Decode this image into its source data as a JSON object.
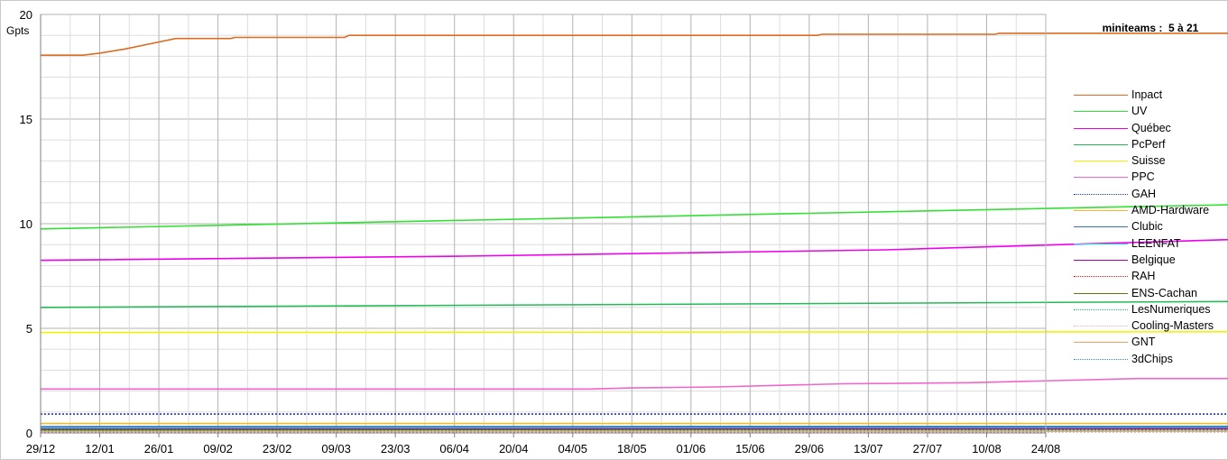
{
  "chart_data": {
    "type": "line",
    "title": "miniteams :  5 à 21",
    "ylabel": "Gpts",
    "xlabel": "",
    "ylim": [
      0,
      20
    ],
    "xlim": [
      "29/12",
      "24/08"
    ],
    "x_start": "29/12",
    "yticks": [
      0,
      5,
      10,
      15,
      20
    ],
    "xticks": [
      "29/12",
      "12/01",
      "26/01",
      "09/02",
      "23/02",
      "09/03",
      "23/03",
      "06/04",
      "20/04",
      "04/05",
      "18/05",
      "01/06",
      "15/06",
      "29/06",
      "13/07",
      "27/07",
      "10/08",
      "24/08"
    ],
    "grid": true,
    "legend_position": "right",
    "series": [
      {
        "name": "Inpact",
        "color": "#dd6b22",
        "dash": "solid",
        "points": [
          [
            0,
            18.05
          ],
          [
            10,
            18.05
          ],
          [
            14,
            18.15
          ],
          [
            20,
            18.35
          ],
          [
            26,
            18.6
          ],
          [
            32,
            18.85
          ],
          [
            45,
            18.85
          ],
          [
            46,
            18.9
          ],
          [
            72,
            18.9
          ],
          [
            73,
            19.0
          ],
          [
            184,
            19.0
          ],
          [
            185,
            19.05
          ],
          [
            226,
            19.05
          ],
          [
            227,
            19.1
          ],
          [
            322,
            19.1
          ],
          [
            323,
            19.15
          ],
          [
            363,
            19.15
          ],
          [
            365,
            19.2
          ],
          [
            380,
            19.4
          ],
          [
            390,
            19.8
          ],
          [
            395,
            19.9
          ],
          [
            402,
            19.95
          ]
        ]
      },
      {
        "name": "UV",
        "color": "#33e033",
        "dash": "solid",
        "points": [
          [
            0,
            9.75
          ],
          [
            402,
            11.4
          ]
        ]
      },
      {
        "name": "Québec",
        "color": "#ee00ee",
        "dash": "solid",
        "points": [
          [
            0,
            8.25
          ],
          [
            100,
            8.45
          ],
          [
            200,
            8.75
          ],
          [
            300,
            9.35
          ],
          [
            402,
            10.0
          ]
        ]
      },
      {
        "name": "PcPerf",
        "color": "#22bb55",
        "dash": "solid",
        "points": [
          [
            0,
            6.0
          ],
          [
            402,
            6.4
          ]
        ]
      },
      {
        "name": "Suisse",
        "color": "#f2f200",
        "dash": "solid",
        "points": [
          [
            0,
            4.8
          ],
          [
            402,
            4.85
          ]
        ]
      },
      {
        "name": "PPC",
        "color": "#ee66cc",
        "dash": "solid",
        "points": [
          [
            0,
            2.1
          ],
          [
            130,
            2.1
          ],
          [
            140,
            2.15
          ],
          [
            160,
            2.2
          ],
          [
            190,
            2.35
          ],
          [
            220,
            2.4
          ],
          [
            240,
            2.5
          ],
          [
            260,
            2.6
          ],
          [
            402,
            2.6
          ]
        ]
      },
      {
        "name": "GAH",
        "color": "#2233cc",
        "dash": "dotted",
        "points": [
          [
            0,
            0.9
          ],
          [
            402,
            0.9
          ]
        ]
      },
      {
        "name": "AMD-Hardware",
        "color": "#f0c020",
        "dash": "solid",
        "points": [
          [
            0,
            0.45
          ],
          [
            402,
            0.45
          ]
        ]
      },
      {
        "name": "Clubic",
        "color": "#3377bb",
        "dash": "solid",
        "points": [
          [
            0,
            0.3
          ],
          [
            402,
            0.32
          ]
        ]
      },
      {
        "name": "LEENFAT",
        "color": "#22dddd",
        "dash": "solid",
        "points": [
          [
            0,
            0.25
          ],
          [
            402,
            0.28
          ]
        ]
      },
      {
        "name": "Belgique",
        "color": "#aa00aa",
        "dash": "solid",
        "points": [
          [
            0,
            0.22
          ],
          [
            402,
            0.22
          ]
        ]
      },
      {
        "name": "RAH",
        "color": "#ee1111",
        "dash": "dotted",
        "points": [
          [
            0,
            0.2
          ],
          [
            402,
            0.2
          ]
        ]
      },
      {
        "name": "ENS-Cachan",
        "color": "#667711",
        "dash": "solid",
        "points": [
          [
            0,
            0.15
          ],
          [
            402,
            0.2
          ]
        ]
      },
      {
        "name": "LesNumeriques",
        "color": "#22bb88",
        "dash": "dotted",
        "points": [
          [
            0,
            0.12
          ],
          [
            402,
            0.15
          ]
        ]
      },
      {
        "name": "Cooling-Masters",
        "color": "#ffaaaa",
        "dash": "dotted",
        "points": [
          [
            0,
            0.1
          ],
          [
            402,
            0.1
          ]
        ]
      },
      {
        "name": "GNT",
        "color": "#f0a060",
        "dash": "solid",
        "points": [
          [
            0,
            0.08
          ],
          [
            402,
            0.08
          ]
        ]
      },
      {
        "name": "3dChips",
        "color": "#3388dd",
        "dash": "dotted",
        "points": [
          [
            0,
            0.06
          ],
          [
            402,
            0.06
          ]
        ]
      }
    ]
  }
}
